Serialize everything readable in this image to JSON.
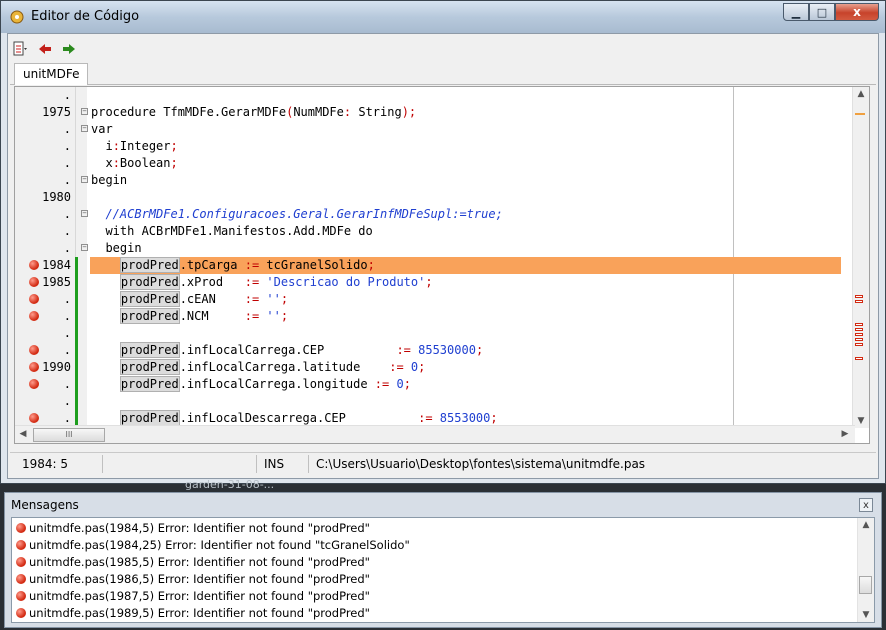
{
  "window": {
    "title": "Editor de Código",
    "caption": {
      "minimize": "▁",
      "maximize": "□",
      "close": "x"
    }
  },
  "toolbar": {
    "icons": [
      "unit-list-icon",
      "arrow-back-icon",
      "arrow-forward-icon"
    ]
  },
  "tabs": [
    {
      "label": "unitMDFe"
    }
  ],
  "editor": {
    "lines": [
      {
        "num": ".",
        "err": false,
        "fold": false,
        "segments": []
      },
      {
        "num": "1975",
        "err": false,
        "fold": true,
        "segments": [
          [
            "kw",
            "procedure TfmMDFe.GerarMDFe"
          ],
          [
            "sym",
            "("
          ],
          [
            "kw",
            "NumMDFe"
          ],
          [
            "sym",
            ":"
          ],
          [
            "kw",
            " String"
          ],
          [
            "sym",
            ");"
          ]
        ]
      },
      {
        "num": ".",
        "err": false,
        "fold": true,
        "segments": [
          [
            "kw",
            "var"
          ]
        ]
      },
      {
        "num": ".",
        "err": false,
        "fold": false,
        "segments": [
          [
            "kw",
            "  i"
          ],
          [
            "sym",
            ":"
          ],
          [
            "kw",
            "Integer"
          ],
          [
            "sym",
            ";"
          ]
        ]
      },
      {
        "num": ".",
        "err": false,
        "fold": false,
        "segments": [
          [
            "kw",
            "  x"
          ],
          [
            "sym",
            ":"
          ],
          [
            "kw",
            "Boolean"
          ],
          [
            "sym",
            ";"
          ]
        ]
      },
      {
        "num": ".",
        "err": false,
        "fold": true,
        "segments": [
          [
            "kw",
            "begin"
          ]
        ]
      },
      {
        "num": "1980",
        "err": false,
        "fold": false,
        "segments": []
      },
      {
        "num": ".",
        "err": false,
        "fold": true,
        "segments": [
          [
            "cmt",
            "  //ACBrMDFe1.Configuracoes.Geral.GerarInfMDFeSupl:=true;"
          ]
        ]
      },
      {
        "num": ".",
        "err": false,
        "fold": false,
        "segments": [
          [
            "kw",
            "  with ACBrMDFe1.Manifestos.Add.MDFe do"
          ]
        ]
      },
      {
        "num": ".",
        "err": false,
        "fold": true,
        "segments": [
          [
            "kw",
            "  begin"
          ]
        ]
      },
      {
        "num": "1984",
        "err": true,
        "fold": false,
        "hl": true,
        "segments": [
          [
            "kw",
            "    "
          ],
          [
            "ref",
            "prodPred"
          ],
          [
            "kw",
            ".tpCarga "
          ],
          [
            "sym",
            ":="
          ],
          [
            "kw",
            " tcGranelSolido"
          ],
          [
            "sym",
            ";"
          ]
        ]
      },
      {
        "num": "1985",
        "err": true,
        "fold": false,
        "segments": [
          [
            "kw",
            "    "
          ],
          [
            "ref",
            "prodPred"
          ],
          [
            "kw",
            ".xProd   "
          ],
          [
            "sym",
            ":="
          ],
          [
            "str",
            " 'Descricao do Produto'"
          ],
          [
            "sym",
            ";"
          ]
        ]
      },
      {
        "num": ".",
        "err": true,
        "fold": false,
        "segments": [
          [
            "kw",
            "    "
          ],
          [
            "ref",
            "prodPred"
          ],
          [
            "kw",
            ".cEAN    "
          ],
          [
            "sym",
            ":="
          ],
          [
            "str",
            " ''"
          ],
          [
            "sym",
            ";"
          ]
        ]
      },
      {
        "num": ".",
        "err": true,
        "fold": false,
        "segments": [
          [
            "kw",
            "    "
          ],
          [
            "ref",
            "prodPred"
          ],
          [
            "kw",
            ".NCM     "
          ],
          [
            "sym",
            ":="
          ],
          [
            "str",
            " ''"
          ],
          [
            "sym",
            ";"
          ]
        ]
      },
      {
        "num": ".",
        "err": false,
        "fold": false,
        "segments": []
      },
      {
        "num": ".",
        "err": true,
        "fold": false,
        "segments": [
          [
            "kw",
            "    "
          ],
          [
            "ref",
            "prodPred"
          ],
          [
            "kw",
            ".infLocalCarrega.CEP          "
          ],
          [
            "sym",
            ":="
          ],
          [
            "num",
            " 85530000"
          ],
          [
            "sym",
            ";"
          ]
        ]
      },
      {
        "num": "1990",
        "err": true,
        "fold": false,
        "segments": [
          [
            "kw",
            "    "
          ],
          [
            "ref",
            "prodPred"
          ],
          [
            "kw",
            ".infLocalCarrega.latitude    "
          ],
          [
            "sym",
            ":="
          ],
          [
            "num",
            " 0"
          ],
          [
            "sym",
            ";"
          ]
        ]
      },
      {
        "num": ".",
        "err": true,
        "fold": false,
        "segments": [
          [
            "kw",
            "    "
          ],
          [
            "ref",
            "prodPred"
          ],
          [
            "kw",
            ".infLocalCarrega.longitude "
          ],
          [
            "sym",
            ":="
          ],
          [
            "num",
            " 0"
          ],
          [
            "sym",
            ";"
          ]
        ]
      },
      {
        "num": ".",
        "err": false,
        "fold": false,
        "segments": []
      },
      {
        "num": ".",
        "err": true,
        "fold": false,
        "segments": [
          [
            "kw",
            "    "
          ],
          [
            "ref",
            "prodPred"
          ],
          [
            "kw",
            ".infLocalDescarrega.CEP          "
          ],
          [
            "sym",
            ":="
          ],
          [
            "num",
            " 8553000"
          ],
          [
            "sym",
            ";"
          ]
        ]
      }
    ],
    "hscroll_thumb": "III"
  },
  "status": {
    "position": "1984:  5",
    "mode": "INS",
    "file": "C:\\Users\\Usuario\\Desktop\\fontes\\sistema\\unitmdfe.pas"
  },
  "taskbar_label": "garden-31-08-...",
  "messages": {
    "title": "Mensagens",
    "close": "x",
    "items": [
      "unitmdfe.pas(1984,5) Error: Identifier not found \"prodPred\"",
      "unitmdfe.pas(1984,25) Error: Identifier not found \"tcGranelSolido\"",
      "unitmdfe.pas(1985,5) Error: Identifier not found \"prodPred\"",
      "unitmdfe.pas(1986,5) Error: Identifier not found \"prodPred\"",
      "unitmdfe.pas(1987,5) Error: Identifier not found \"prodPred\"",
      "unitmdfe.pas(1989,5) Error: Identifier not found \"prodPred\""
    ]
  }
}
